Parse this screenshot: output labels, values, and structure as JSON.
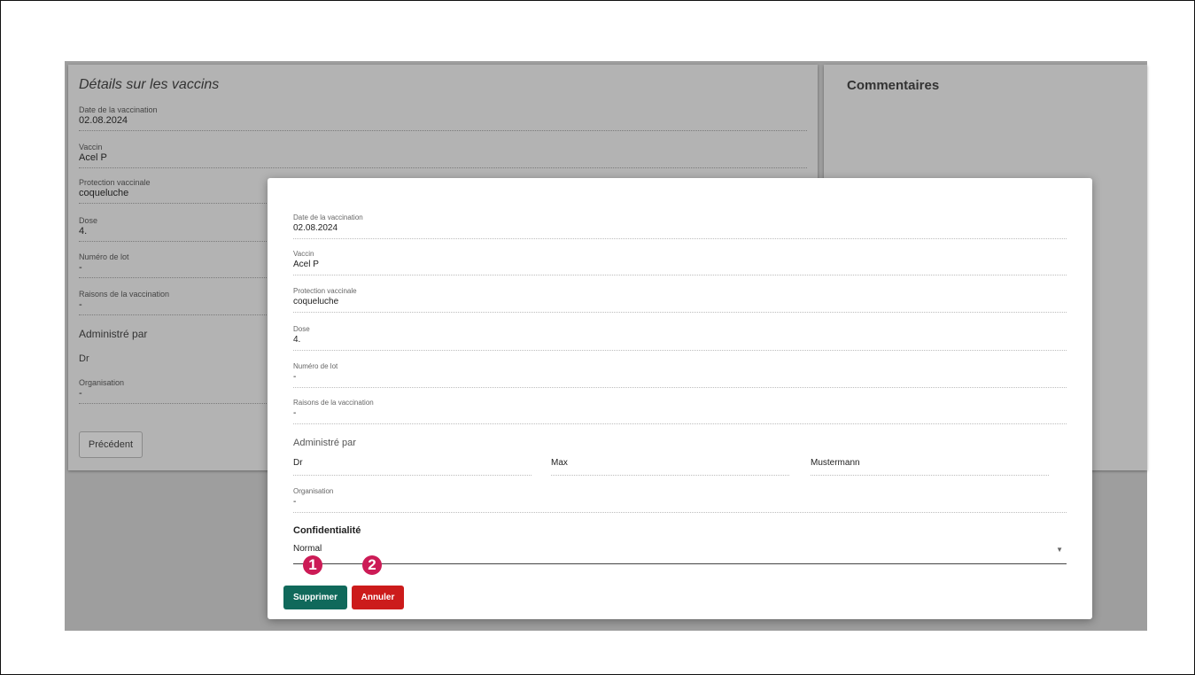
{
  "background": {
    "details_title": "Détails sur les vaccins",
    "comments_title": "Commentaires",
    "fields": [
      {
        "label": "Date de la vaccination",
        "value": "02.08.2024"
      },
      {
        "label": "Vaccin",
        "value": "Acel P"
      },
      {
        "label": "Protection vaccinale",
        "value": "coqueluche"
      },
      {
        "label": "Dose",
        "value": "4."
      },
      {
        "label": "Numéro de lot",
        "value": "-"
      },
      {
        "label": "Raisons de la vaccination",
        "value": "-"
      }
    ],
    "administered_by_label": "Administré par",
    "administered_title": "Dr",
    "organisation": {
      "label": "Organisation",
      "value": "-"
    },
    "previous_button": "Précédent"
  },
  "modal": {
    "fields": [
      {
        "label": "Date de la vaccination",
        "value": "02.08.2024"
      },
      {
        "label": "Vaccin",
        "value": "Acel P"
      },
      {
        "label": "Protection vaccinale",
        "value": "coqueluche"
      },
      {
        "label": "Dose",
        "value": "4."
      },
      {
        "label": "Numéro de lot",
        "value": "-"
      },
      {
        "label": "Raisons de la vaccination",
        "value": "-"
      }
    ],
    "administered_by_label": "Administré par",
    "administered_by": {
      "title": "Dr",
      "first_name": "Max",
      "last_name": "Mustermann"
    },
    "organisation": {
      "label": "Organisation",
      "value": "-"
    },
    "confidentiality_label": "Confidentialité",
    "confidentiality_value": "Normal",
    "delete_button": "Supprimer",
    "cancel_button": "Annuler",
    "badges": [
      "1",
      "2"
    ]
  },
  "colors": {
    "delete": "#10695b",
    "cancel": "#cc1b1b",
    "badge": "#cc1b56"
  }
}
